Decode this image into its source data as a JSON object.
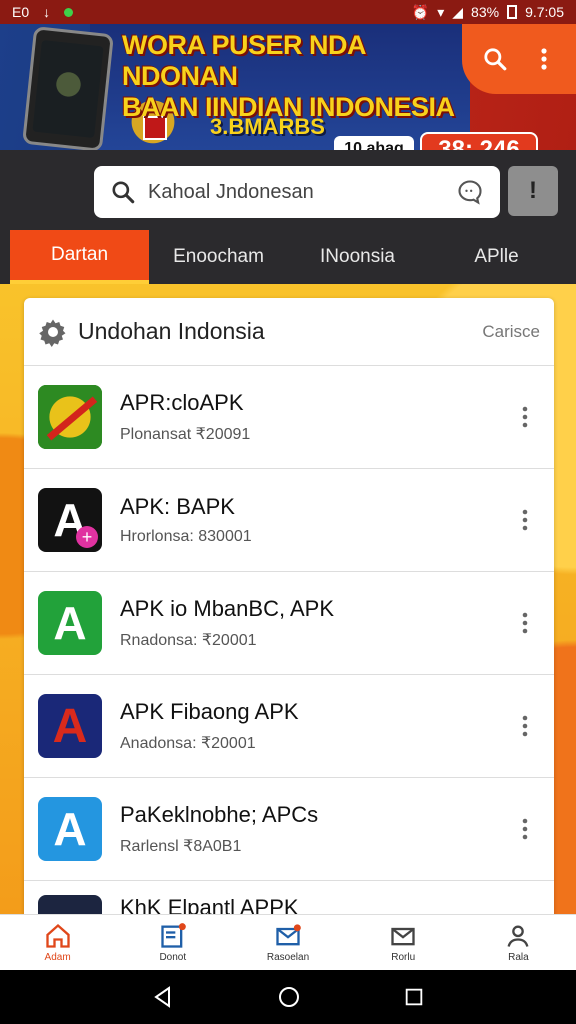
{
  "status_bar": {
    "left_text": "E0",
    "battery": "83%",
    "time": "9.7:05"
  },
  "banner": {
    "title_line1": "WORA PUSER NDA NDONAN",
    "title_line2": "BAAN IINDIAN INDONESIA",
    "brand": "3.BMARBS",
    "pill_white": "10 ahaq",
    "pill_red": "38: 246"
  },
  "search": {
    "placeholder": "Kahoal Jndonesan",
    "voice_label": "!"
  },
  "tabs": [
    {
      "label": "Dartan",
      "active": true
    },
    {
      "label": "Enoocham",
      "active": false
    },
    {
      "label": "INoonsia",
      "active": false
    },
    {
      "label": "APlle",
      "active": false
    }
  ],
  "card": {
    "title": "Undohan Indonsia",
    "action": "Carisce"
  },
  "apps": [
    {
      "name": "APR:cloAPK",
      "sub": "Plonansat ₹20091",
      "icon": "mobile-legends-icon",
      "color": "#2d8a22",
      "accent": "#d3241c"
    },
    {
      "name": "APK: BAPK",
      "sub": "Hrorlonsa: 830001",
      "icon": "a-letter-icon",
      "color": "#121212",
      "accent": "#e032a0"
    },
    {
      "name": "APK io MbanBC, APK",
      "sub": "Rnadonsa: ₹20001",
      "icon": "green-a-icon",
      "color": "#22a23a",
      "accent": "#ffffff"
    },
    {
      "name": "APK Fibaong APK",
      "sub": "Anadonsa: ₹20001",
      "icon": "red-a-icon",
      "color": "#1a2878",
      "accent": "#d92a1c"
    },
    {
      "name": "PaKeklnobhe; APCs",
      "sub": "Rarlensl ₹8A0B1",
      "icon": "blue-a-icon",
      "color": "#2496e0",
      "accent": "#ffffff"
    },
    {
      "name": "KhK Elpantl APPK",
      "sub": "",
      "icon": "dark-app-icon",
      "color": "#1c2540",
      "accent": "#ffffff"
    }
  ],
  "bottom_nav": [
    {
      "label": "Adam",
      "icon": "home-icon",
      "active": true
    },
    {
      "label": "Donot",
      "icon": "news-icon",
      "active": false
    },
    {
      "label": "Rasoelan",
      "icon": "send-icon",
      "active": false
    },
    {
      "label": "Rorlu",
      "icon": "mail-icon",
      "active": false
    },
    {
      "label": "Rala",
      "icon": "profile-icon",
      "active": false
    }
  ],
  "colors": {
    "accent": "#f04a16",
    "banner_red": "#b01f14",
    "banner_blue": "#1d3f8a",
    "search_zone": "#2b2a2d"
  }
}
